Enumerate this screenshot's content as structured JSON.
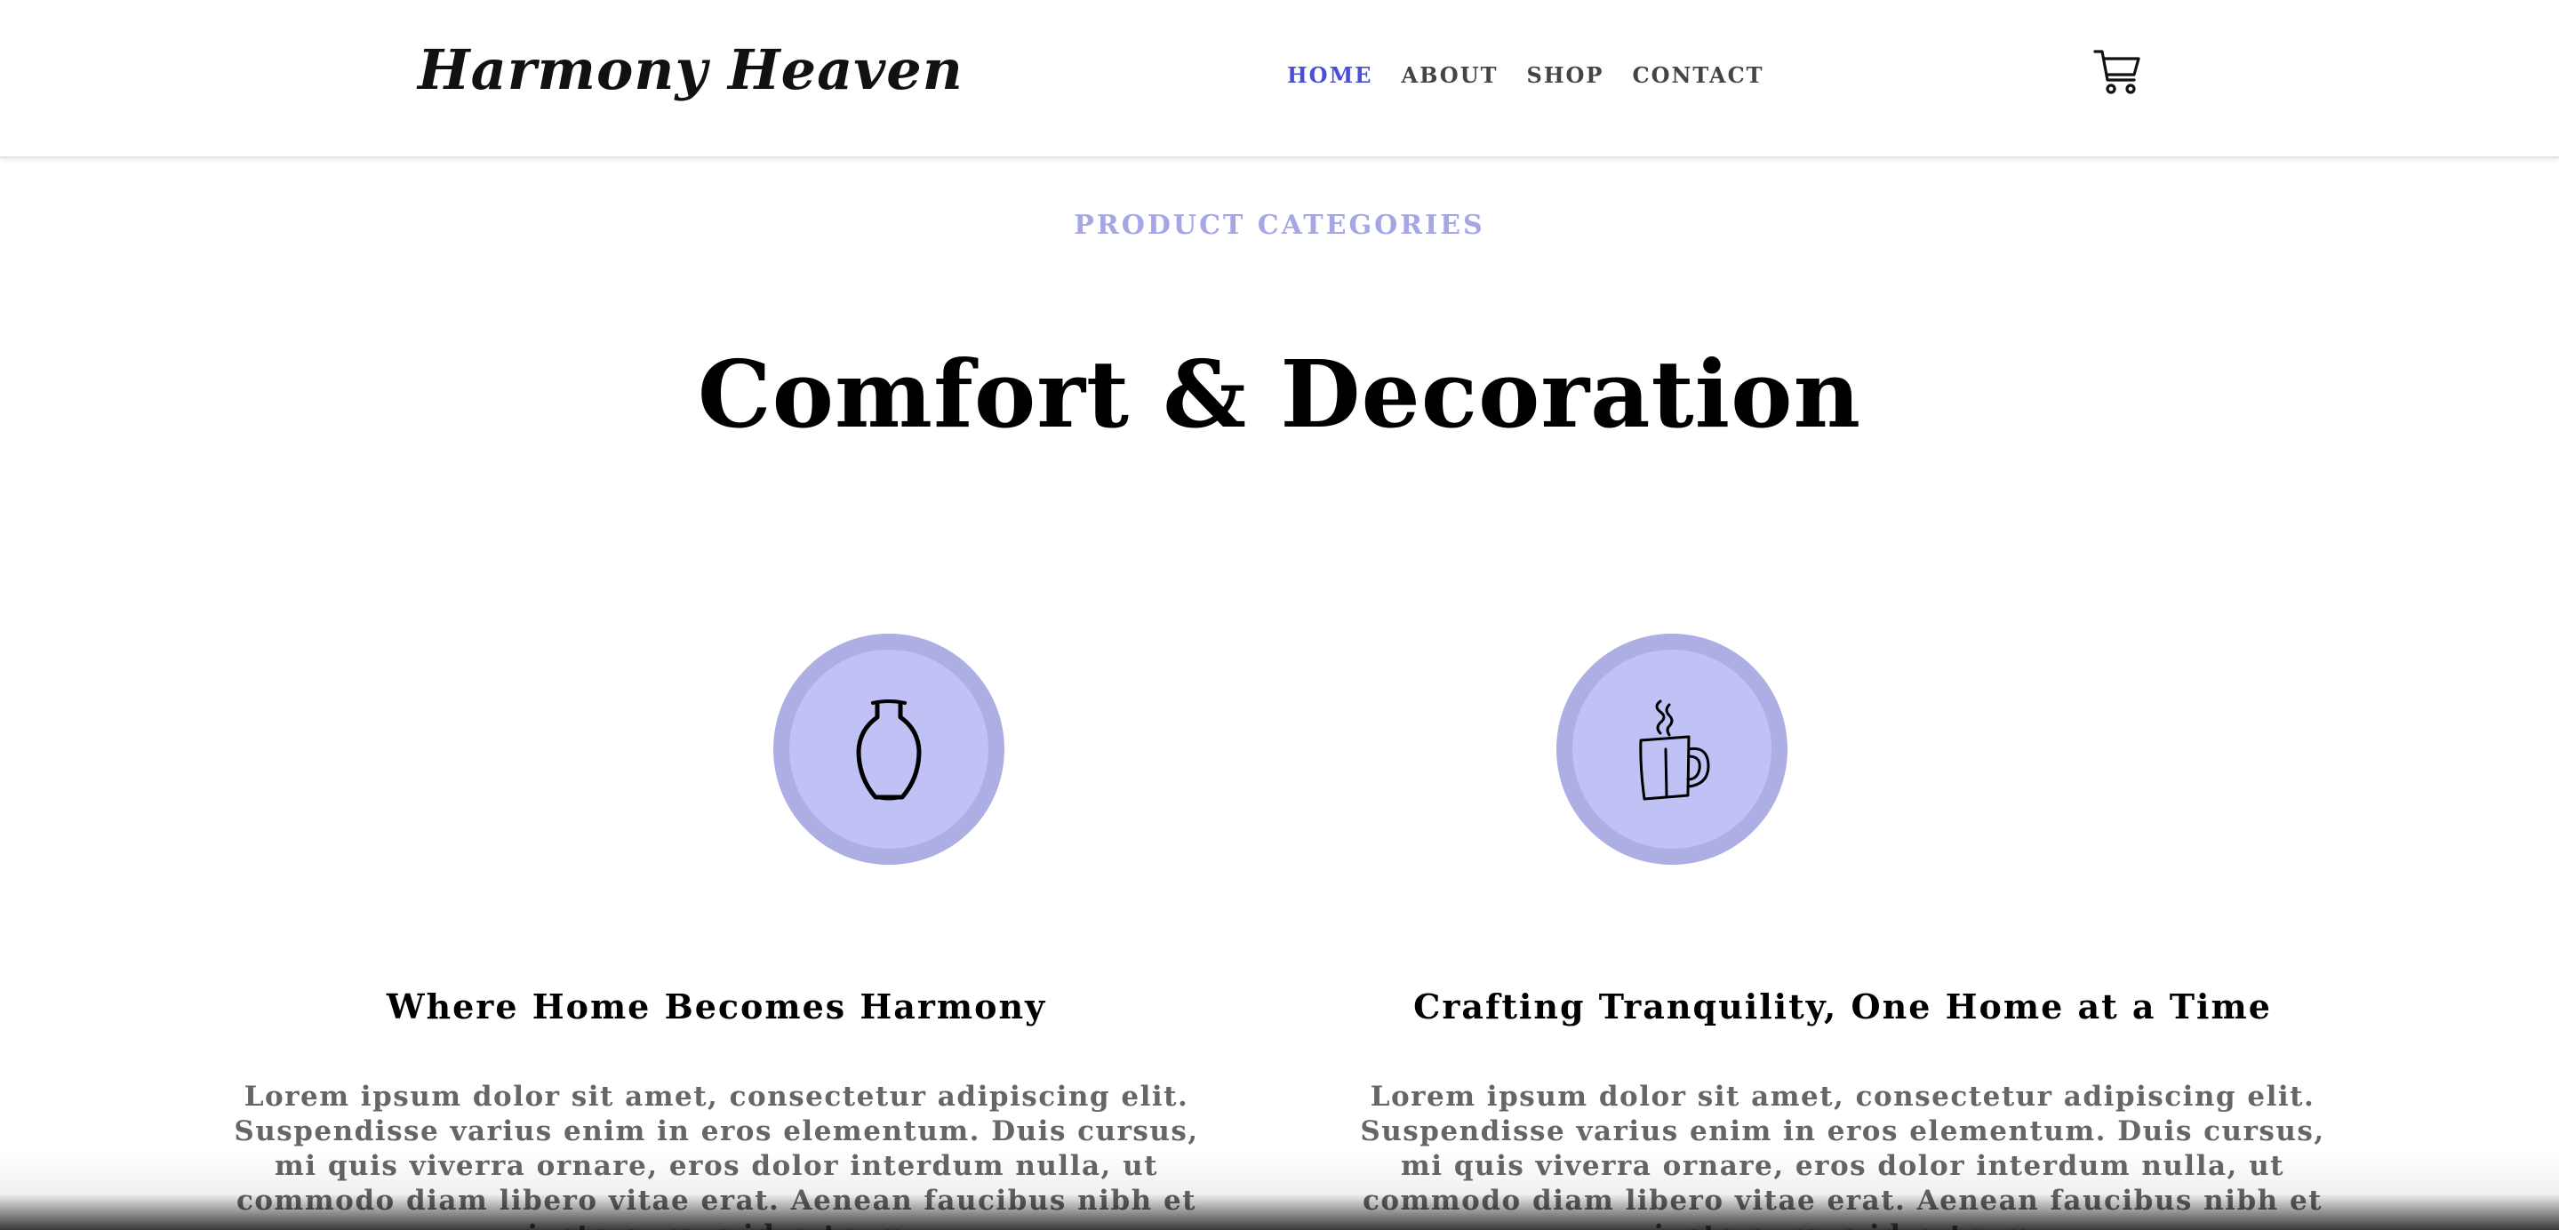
{
  "header": {
    "logo": "Harmony Heaven",
    "nav": [
      "HOME",
      "ABOUT",
      "SHOP",
      "CONTACT"
    ],
    "active_nav": "HOME",
    "cart_icon": "cart-icon"
  },
  "section": {
    "eyebrow": "PRODUCT CATEGORIES",
    "headline": "Comfort & Decoration"
  },
  "cards": [
    {
      "icon": "vase-icon",
      "title": "Where Home Becomes Harmony",
      "text": "Lorem ipsum dolor sit amet, consectetur adipiscing elit. Suspendisse varius enim in eros elementum. Duis cursus, mi quis viverra ornare, eros dolor interdum nulla, ut commodo diam libero vitae erat. Aenean faucibus nibh et justo cursus id rutrum"
    },
    {
      "icon": "mug-icon",
      "title": "Crafting Tranquility, One Home at a Time",
      "text": "Lorem ipsum dolor sit amet, consectetur adipiscing elit. Suspendisse varius enim in eros elementum. Duis cursus, mi quis viverra ornare, eros dolor interdum nulla, ut commodo diam libero vitae erat. Aenean faucibus nibh et justo cursus id rutrum"
    }
  ],
  "colors": {
    "accent": "#4b4ed8",
    "eyebrow": "#a4a6e6",
    "badge_outer": "#adaee3",
    "badge_inner": "#c0c1f5",
    "body_text": "#666666"
  }
}
